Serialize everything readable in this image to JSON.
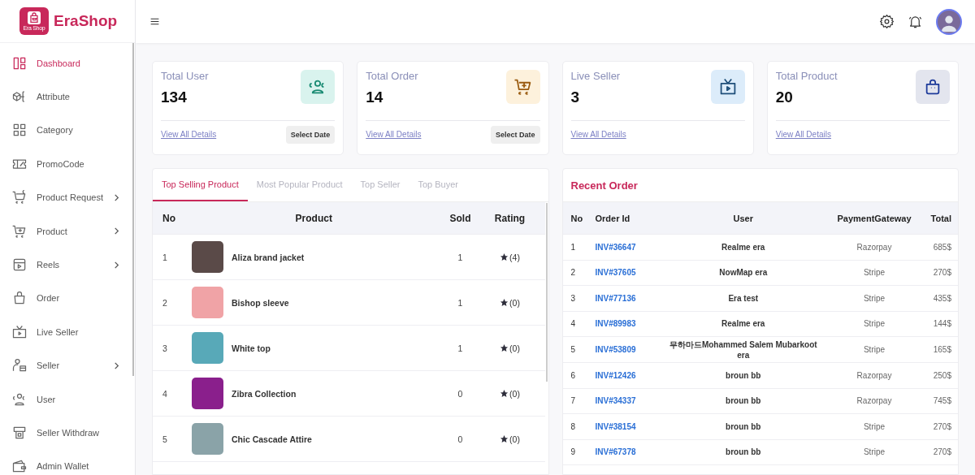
{
  "brand": {
    "name": "EraShop",
    "logo_caption": "Era Shop"
  },
  "sidebar": {
    "items": [
      {
        "label": "Dashboard",
        "selected": true,
        "has_submenu": false
      },
      {
        "label": "Attribute",
        "selected": false,
        "has_submenu": false
      },
      {
        "label": "Category",
        "selected": false,
        "has_submenu": false
      },
      {
        "label": "PromoCode",
        "selected": false,
        "has_submenu": false
      },
      {
        "label": "Product Request",
        "selected": false,
        "has_submenu": true
      },
      {
        "label": "Product",
        "selected": false,
        "has_submenu": true
      },
      {
        "label": "Reels",
        "selected": false,
        "has_submenu": true
      },
      {
        "label": "Order",
        "selected": false,
        "has_submenu": false
      },
      {
        "label": "Live Seller",
        "selected": false,
        "has_submenu": false
      },
      {
        "label": "Seller",
        "selected": false,
        "has_submenu": true
      },
      {
        "label": "User",
        "selected": false,
        "has_submenu": false
      },
      {
        "label": "Seller Withdraw",
        "selected": false,
        "has_submenu": false
      },
      {
        "label": "Admin Wallet",
        "selected": false,
        "has_submenu": false
      }
    ]
  },
  "stats": [
    {
      "title": "Total User",
      "value": "134",
      "link": "View All Details",
      "button": "Select Date"
    },
    {
      "title": "Total Order",
      "value": "14",
      "link": "View All Details",
      "button": "Select Date"
    },
    {
      "title": "Live Seller",
      "value": "3",
      "link": "View All Details"
    },
    {
      "title": "Total Product",
      "value": "20",
      "link": "View All Details"
    }
  ],
  "products_panel": {
    "tabs": [
      {
        "label": "Top Selling Product",
        "selected": true
      },
      {
        "label": "Most Popular Product",
        "selected": false
      },
      {
        "label": "Top Seller",
        "selected": false
      },
      {
        "label": "Top Buyer",
        "selected": false
      }
    ],
    "columns": [
      "No",
      "Product",
      "Sold",
      "Rating"
    ],
    "rows": [
      {
        "no": "1",
        "product": "Aliza brand jacket",
        "sold": "1",
        "rating": "(4)"
      },
      {
        "no": "2",
        "product": "Bishop sleeve",
        "sold": "1",
        "rating": "(0)"
      },
      {
        "no": "3",
        "product": "White top",
        "sold": "1",
        "rating": "(0)"
      },
      {
        "no": "4",
        "product": "Zibra Collection",
        "sold": "0",
        "rating": "(0)"
      },
      {
        "no": "5",
        "product": "Chic Cascade Attire",
        "sold": "0",
        "rating": "(0)"
      }
    ]
  },
  "recent_orders": {
    "title": "Recent Order",
    "columns": [
      "No",
      "Order Id",
      "User",
      "PaymentGateway",
      "Total"
    ],
    "rows": [
      {
        "no": "1",
        "order_id": "INV#36647",
        "user": "Realme era",
        "gateway": "Razorpay",
        "total": "685$"
      },
      {
        "no": "2",
        "order_id": "INV#37605",
        "user": "NowMap era",
        "gateway": "Stripe",
        "total": "270$"
      },
      {
        "no": "3",
        "order_id": "INV#77136",
        "user": "Era test",
        "gateway": "Stripe",
        "total": "435$"
      },
      {
        "no": "4",
        "order_id": "INV#89983",
        "user": "Realme era",
        "gateway": "Stripe",
        "total": "144$"
      },
      {
        "no": "5",
        "order_id": "INV#53809",
        "user": "무하마드Mohammed Salem Mubarkoot era",
        "gateway": "Stripe",
        "total": "165$"
      },
      {
        "no": "6",
        "order_id": "INV#12426",
        "user": "broun bb",
        "gateway": "Razorpay",
        "total": "250$"
      },
      {
        "no": "7",
        "order_id": "INV#34337",
        "user": "broun bb",
        "gateway": "Razorpay",
        "total": "745$"
      },
      {
        "no": "8",
        "order_id": "INV#38154",
        "user": "broun bb",
        "gateway": "Stripe",
        "total": "270$"
      },
      {
        "no": "9",
        "order_id": "INV#67378",
        "user": "broun bb",
        "gateway": "Stripe",
        "total": "270$"
      }
    ]
  }
}
